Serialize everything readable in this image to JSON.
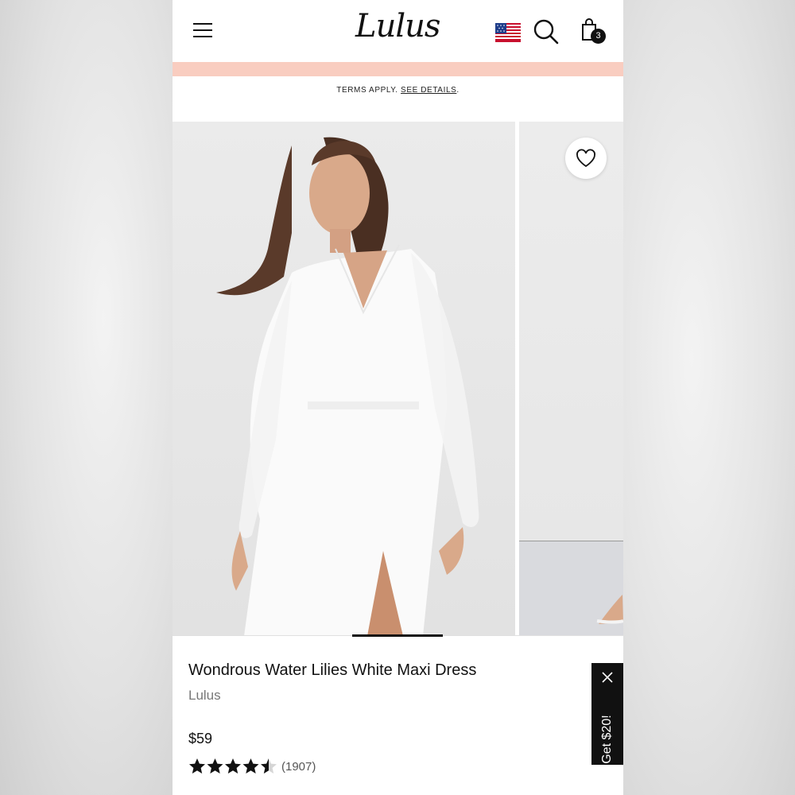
{
  "header": {
    "logo_text": "Lulus",
    "cart_count": "3",
    "flag_icon": "us-flag-icon"
  },
  "promo": {
    "color": "#f9cdc0",
    "terms_text": "TERMS APPLY.",
    "details_link": "SEE DETAILS"
  },
  "product": {
    "title": "Wondrous Water Lilies White Maxi Dress",
    "brand": "Lulus",
    "price": "$59",
    "rating": 4.5,
    "review_count": "(1907)"
  },
  "popup": {
    "label": "Get $20!"
  }
}
